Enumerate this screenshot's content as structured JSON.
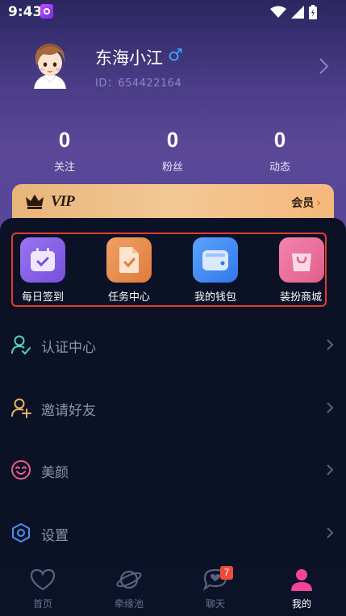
{
  "status_bar": {
    "time": "9:43"
  },
  "profile": {
    "nickname": "东海小江",
    "gender_symbol": "♂",
    "id_text": "ID：654422164"
  },
  "stats": [
    {
      "value": "0",
      "label": "关注"
    },
    {
      "value": "0",
      "label": "粉丝"
    },
    {
      "value": "0",
      "label": "动态"
    }
  ],
  "vip": {
    "badge_text": "VIP",
    "member_label": "会员",
    "member_arrow": "›"
  },
  "quick_actions": [
    {
      "label": "每日签到",
      "icon": "calendar-check-icon",
      "color": "#8a63e8"
    },
    {
      "label": "任务中心",
      "icon": "task-document-icon",
      "color": "#e98e50"
    },
    {
      "label": "我的钱包",
      "icon": "wallet-icon",
      "color": "#3b8cf4"
    },
    {
      "label": "装扮商城",
      "icon": "shopping-bag-icon",
      "color": "#ec6f9c"
    }
  ],
  "menu": [
    {
      "label": "认证中心",
      "icon": "verified-user-icon",
      "color": "#4fd6c0"
    },
    {
      "label": "邀请好友",
      "icon": "add-user-icon",
      "color": "#e8b05a"
    },
    {
      "label": "美颜",
      "icon": "smile-face-icon",
      "color": "#f05a8a"
    },
    {
      "label": "设置",
      "icon": "settings-hexagon-icon",
      "color": "#4e8ef5"
    }
  ],
  "bottom_nav": [
    {
      "label": "首页",
      "icon": "heart-icon",
      "active": false
    },
    {
      "label": "牵缘池",
      "icon": "planet-icon",
      "active": false
    },
    {
      "label": "聊天",
      "icon": "chat-heart-icon",
      "active": false,
      "badge": "7"
    },
    {
      "label": "我的",
      "icon": "person-icon",
      "active": true
    }
  ],
  "colors": {
    "accent_pink": "#f3449a",
    "highlight_border": "#e53a2f",
    "vip_gold": "#f3c895"
  }
}
